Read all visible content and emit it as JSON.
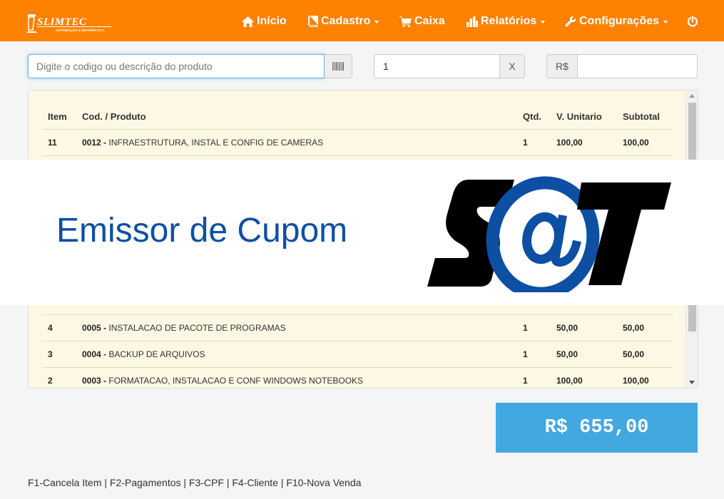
{
  "brand": {
    "name": "SLIMTEC",
    "tagline": "AUTOMAÇÃO & INFORMÁTICA"
  },
  "nav": {
    "inicio": "Início",
    "cadastro": "Cadastro",
    "caixa": "Caixa",
    "relatorios": "Relatórios",
    "configuracoes": "Configurações"
  },
  "search": {
    "placeholder": "Digite o codigo ou descrição do produto",
    "value": ""
  },
  "quantity": {
    "value": "1",
    "clear_label": "X"
  },
  "price": {
    "prefix": "R$",
    "value": ""
  },
  "table": {
    "headers": {
      "item": "Item",
      "produto": "Cod. / Produto",
      "qtd": "Qtd.",
      "unit": "V. Unitario",
      "subtotal": "Subtotal"
    },
    "rows": [
      {
        "item": "11",
        "code": "0012",
        "desc": "INFRAESTRUTURA, INSTAL E CONFIG DE CAMERAS",
        "qtd": "1",
        "unit": "100,00",
        "subtotal": "100,00"
      },
      {
        "item": "4",
        "code": "0005",
        "desc": "INSTALACAO DE PACOTE DE PROGRAMAS",
        "qtd": "1",
        "unit": "50,00",
        "subtotal": "50,00"
      },
      {
        "item": "3",
        "code": "0004",
        "desc": "BACKUP DE ARQUIVOS",
        "qtd": "1",
        "unit": "50,00",
        "subtotal": "50,00"
      },
      {
        "item": "2",
        "code": "0003",
        "desc": "FORMATACAO, INSTALACAO E CONF WINDOWS NOTEBOOKS",
        "qtd": "1",
        "unit": "100,00",
        "subtotal": "100,00"
      }
    ]
  },
  "banner": {
    "title": "Emissor de Cupom",
    "logo_text": "S@T",
    "logo_colors": {
      "letters": "#000000",
      "at_sign": "#0d4fa3"
    }
  },
  "total": {
    "text": "R$ 655,00"
  },
  "shortcuts": "F1-Cancela Item | F2-Pagamentos | F3-CPF | F4-Cliente | F10-Nova Venda",
  "colors": {
    "navbar": "#ff8100",
    "total_bg": "#42a8e0",
    "table_bg": "#fcf8e3",
    "banner_text": "#0d4fa3"
  }
}
